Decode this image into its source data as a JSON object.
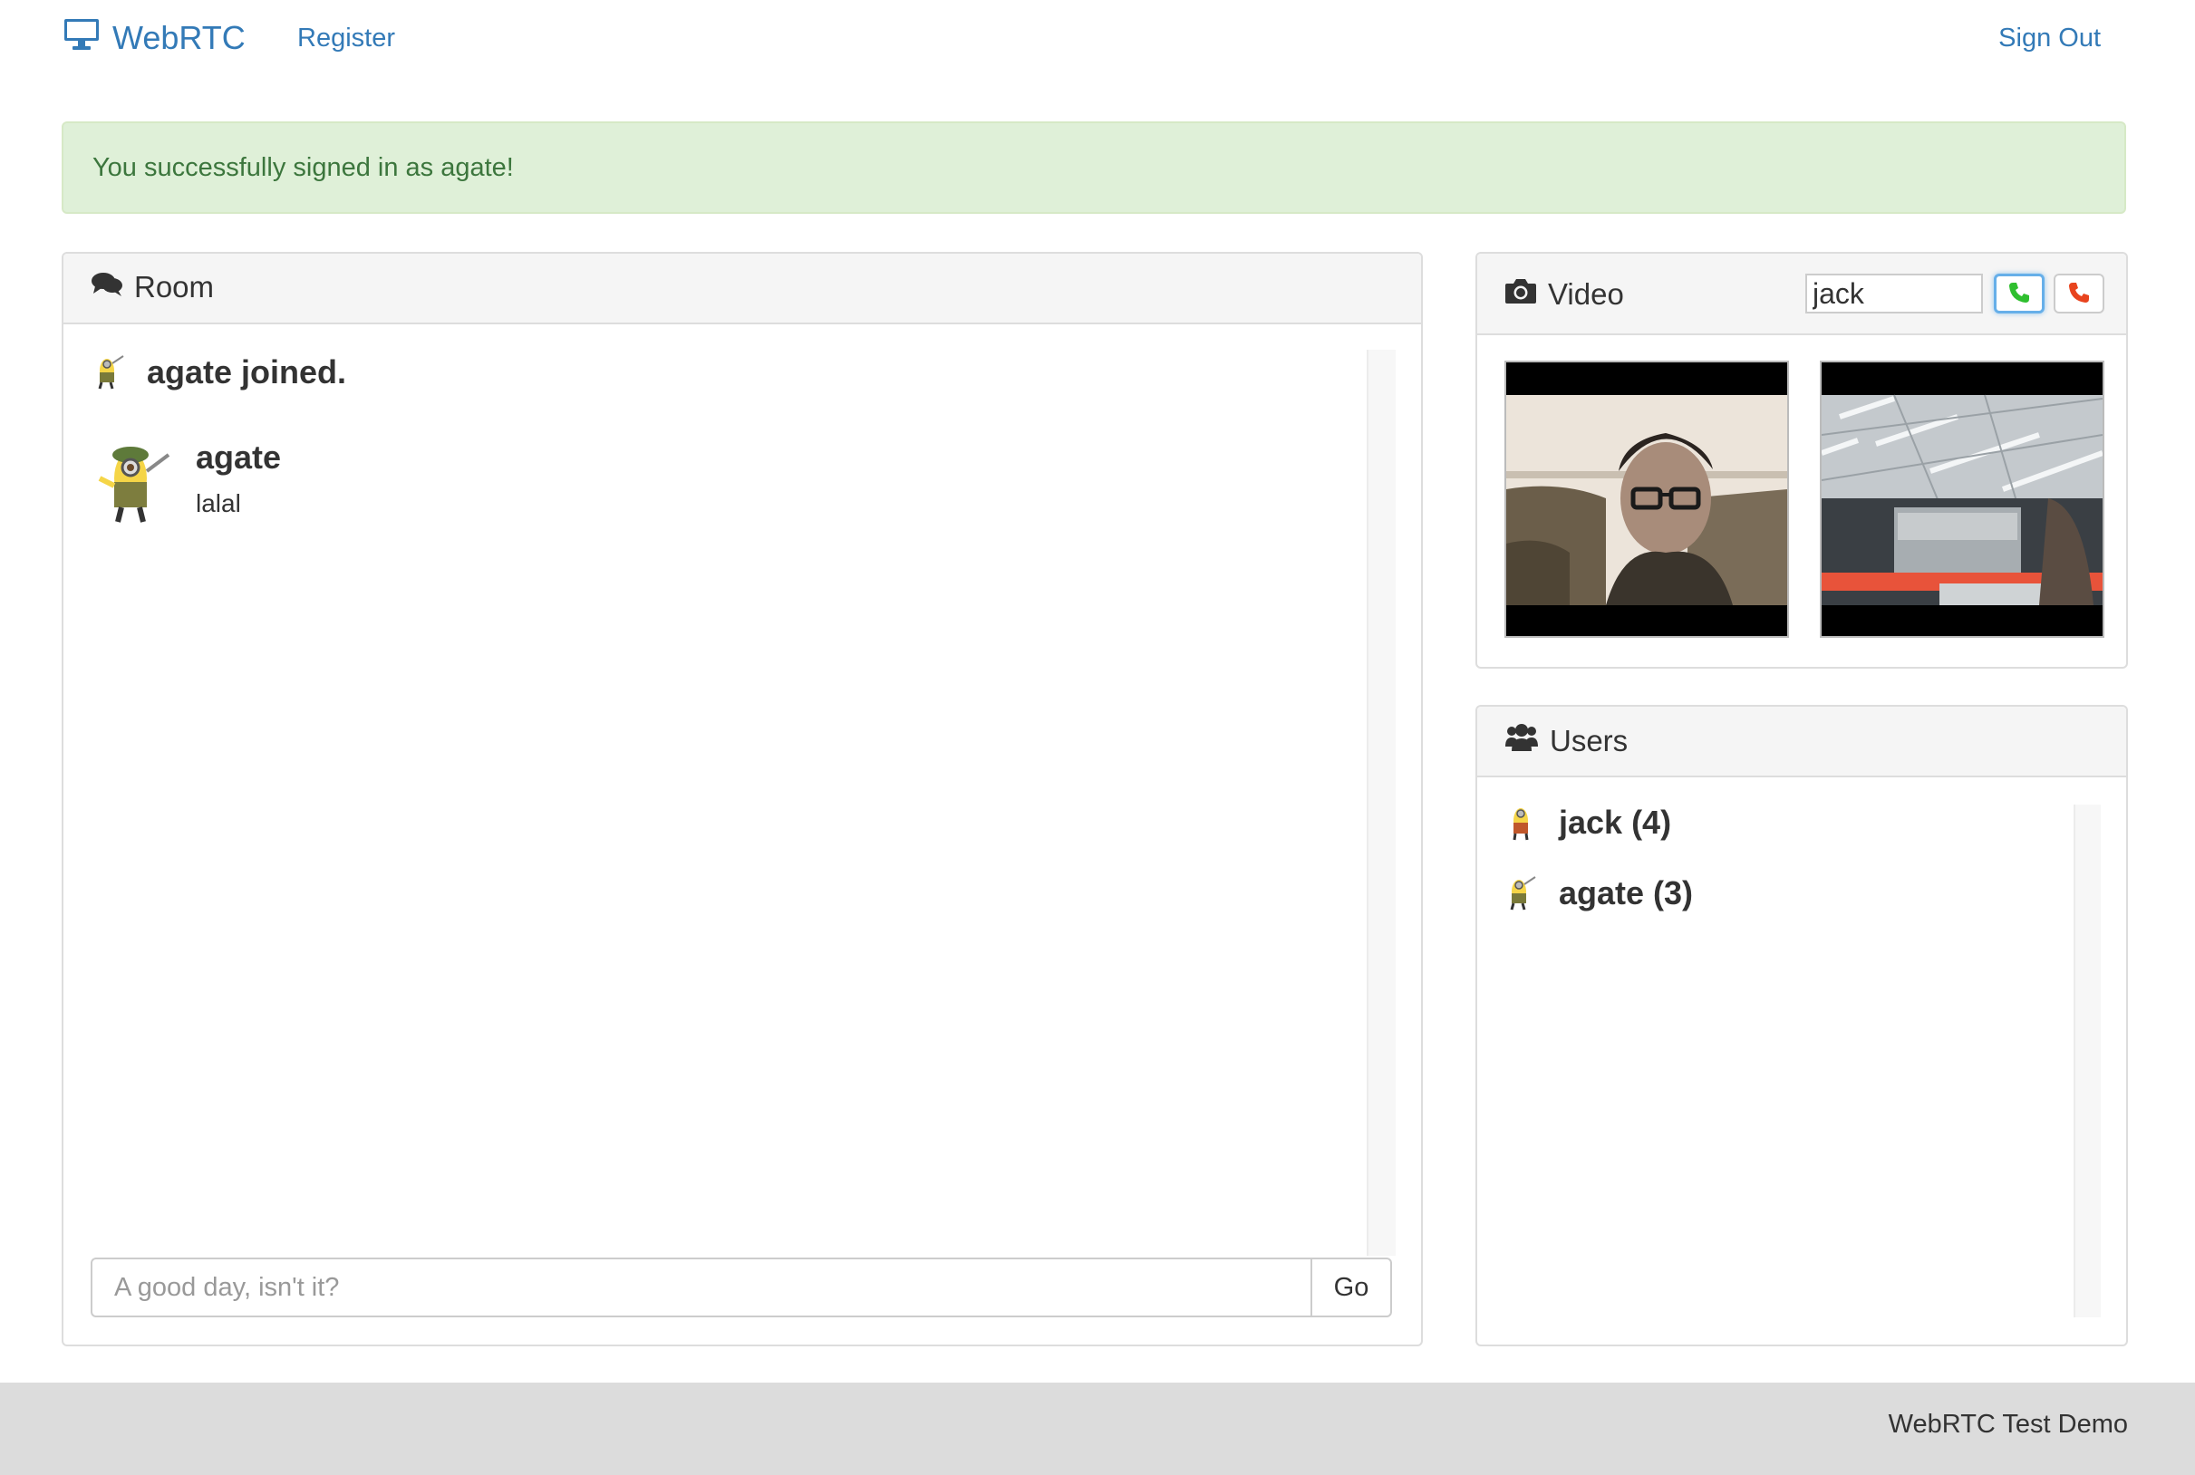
{
  "navbar": {
    "brand": "WebRTC",
    "brand_icon": "monitor-icon",
    "register_label": "Register",
    "signout_label": "Sign Out"
  },
  "alert": {
    "message": "You successfully signed in as agate!"
  },
  "room": {
    "title": "Room",
    "icon": "comments-icon",
    "system_message": "agate joined.",
    "messages": [
      {
        "author": "agate",
        "text": "lalal"
      }
    ],
    "input_placeholder": "A good day, isn't it?",
    "send_label": "Go"
  },
  "video": {
    "title": "Video",
    "icon": "camera-icon",
    "peer_value": "jack",
    "call_icon": "phone-green-icon",
    "hangup_icon": "phone-red-icon"
  },
  "users": {
    "title": "Users",
    "icon": "users-icon",
    "list": [
      {
        "label": "jack (4)"
      },
      {
        "label": "agate (3)"
      }
    ]
  },
  "footer": {
    "text": "WebRTC Test Demo"
  },
  "colors": {
    "link": "#337ab7",
    "alert_bg": "#dff0d8",
    "alert_text": "#3c763d",
    "footer_bg": "#dcdcdc"
  }
}
